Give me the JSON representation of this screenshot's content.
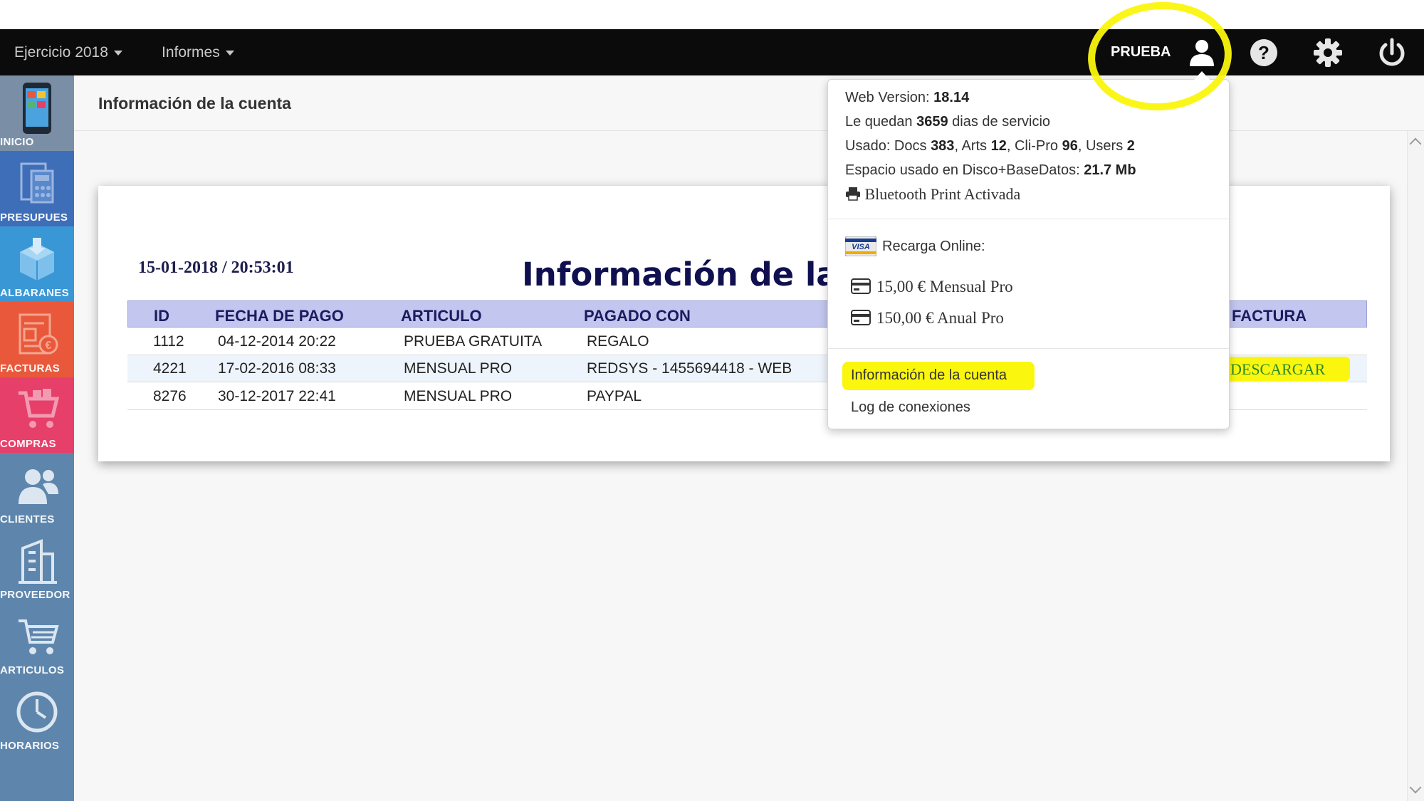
{
  "navbar": {
    "year_menu": "Ejercicio 2018",
    "reports_menu": "Informes",
    "user_name": "PRUEBA"
  },
  "sidebar": {
    "items": [
      {
        "label": "INICIO",
        "color": "#7a8fa6"
      },
      {
        "label": "PRESUPUES",
        "color": "#3e6eb8"
      },
      {
        "label": "ALBARANES",
        "color": "#3a97d6"
      },
      {
        "label": "FACTURAS",
        "color": "#e9583a"
      },
      {
        "label": "COMPRAS",
        "color": "#e6406a"
      },
      {
        "label": "CLIENTES",
        "color": "#5e86ad"
      },
      {
        "label": "PROVEEDOR",
        "color": "#5e86ad"
      },
      {
        "label": "ARTICULOS",
        "color": "#5e86ad"
      },
      {
        "label": "HORARIOS",
        "color": "#5e86ad"
      }
    ]
  },
  "page": {
    "header_title": "Información de la cuenta",
    "datetime": "15-01-2018 / 20:53:01",
    "card_title": "Información de la"
  },
  "table": {
    "columns": [
      "ID",
      "FECHA DE PAGO",
      "ARTICULO",
      "PAGADO CON",
      "FACTURA"
    ],
    "rows": [
      {
        "id": "1112",
        "date": "04-12-2014 20:22",
        "article": "PRUEBA GRATUITA",
        "paid_with": "REGALO",
        "invoice": ""
      },
      {
        "id": "4221",
        "date": "17-02-2016 08:33",
        "article": "MENSUAL PRO",
        "paid_with": "REDSYS - 1455694418 - WEB",
        "invoice": "DESCARGAR"
      },
      {
        "id": "8276",
        "date": "30-12-2017 22:41",
        "article": "MENSUAL PRO",
        "paid_with": "PAYPAL",
        "invoice": ""
      }
    ]
  },
  "dropdown": {
    "web_version_label": "Web Version:",
    "web_version": "18.14",
    "days_prefix": "Le quedan",
    "days_value": "3659",
    "days_suffix": "dias de servicio",
    "usage_label": "Usado: Docs",
    "docs": "383",
    "arts_label": ", Arts",
    "arts": "12",
    "clipro_label": ", Cli-Pro",
    "clipro": "96",
    "users_label": ", Users",
    "users": "2",
    "space_label": "Espacio usado en Disco+BaseDatos:",
    "space_value": "21.7 Mb",
    "bluetooth": "Bluetooth Print Activada",
    "recharge_label": "Recarga Online:",
    "plan_monthly": "15,00 € Mensual Pro",
    "plan_yearly": "150,00 € Anual Pro",
    "link_account": "Información de la cuenta",
    "link_log": "Log de conexiones"
  },
  "colors": {
    "navbar": "#0b0b0b",
    "sidebar": "#5e86ad",
    "highlight": "#fbf60d",
    "table_header": "#c3c6ee",
    "title_text": "#101050"
  }
}
